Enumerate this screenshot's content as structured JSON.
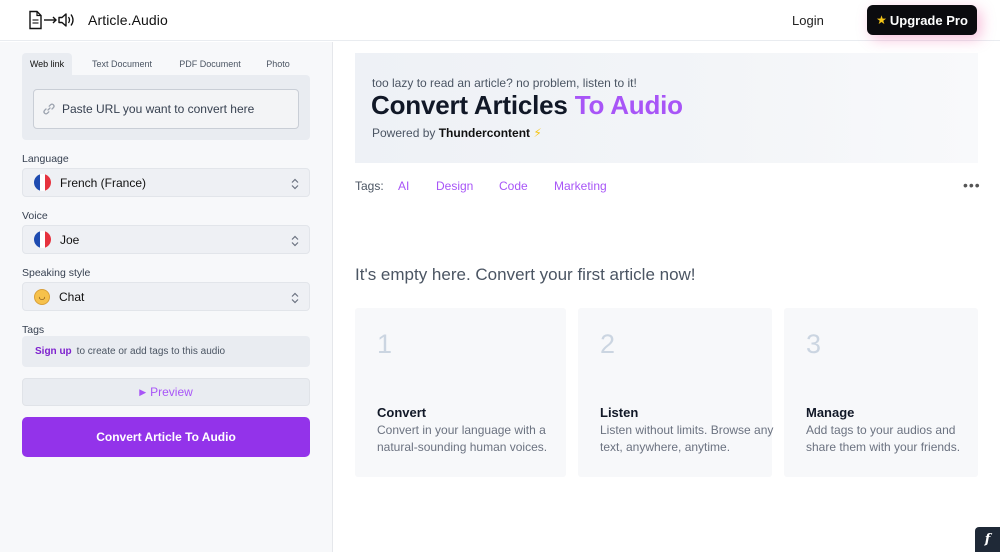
{
  "header": {
    "logo_text": "Article.Audio",
    "login_label": "Login",
    "upgrade_label": "Upgrade Pro",
    "upgrade_icon": "star-icon"
  },
  "sidebar": {
    "tabs": [
      {
        "label": "Web link",
        "active": true
      },
      {
        "label": "Text Document",
        "active": false
      },
      {
        "label": "PDF Document",
        "active": false
      },
      {
        "label": "Photo",
        "active": false
      }
    ],
    "url_placeholder": "Paste URL you want to convert here",
    "language": {
      "label": "Language",
      "value": "French (France)",
      "icon": "france-flag-icon"
    },
    "voice": {
      "label": "Voice",
      "value": "Joe",
      "icon": "france-flag-icon"
    },
    "speaking_style": {
      "label": "Speaking style",
      "value": "Chat",
      "icon": "smiling-face-icon"
    },
    "tags": {
      "label": "Tags",
      "signup_label": "Sign up",
      "signup_text": "to create or add tags to this audio"
    },
    "preview_label": "Preview",
    "convert_label": "Convert Article To Audio"
  },
  "main": {
    "hero": {
      "tagline": "too lazy to read an article? no problem, listen to it!",
      "title_main": "Convert Articles",
      "title_accent": "To Audio",
      "powered_prefix": "Powered by",
      "powered_brand": "Thundercontent",
      "powered_icon": "⚡"
    },
    "tags_label": "Tags:",
    "tags": [
      "AI",
      "Design",
      "Code",
      "Marketing"
    ],
    "more_label": "•••",
    "empty_title": "It's empty here. Convert your first article now!",
    "steps": [
      {
        "number": "1",
        "title": "Convert",
        "description": "Convert in your language with a natural-sounding human voices."
      },
      {
        "number": "2",
        "title": "Listen",
        "description": "Listen without limits. Browse any text, anywhere, anytime."
      },
      {
        "number": "3",
        "title": "Manage",
        "description": "Add tags to your audios and share them with your friends."
      }
    ]
  },
  "colors": {
    "accent": "#a855f7",
    "button_purple": "#9333ea",
    "upgrade_bg": "#0b0b0f",
    "signup_link": "#7e22ce",
    "france_blue": "#1e4bb0",
    "france_red": "#e6323e"
  },
  "corner_badge": "f"
}
